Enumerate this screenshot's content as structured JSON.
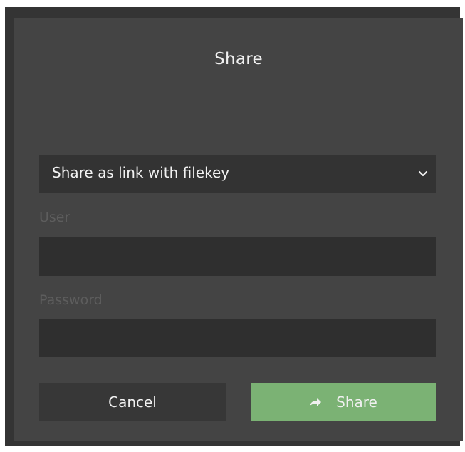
{
  "dialog": {
    "title": "Share",
    "share_mode": {
      "selected": "Share as link with filekey",
      "icon": "chevron-down-icon"
    },
    "user": {
      "label": "User",
      "value": ""
    },
    "password": {
      "label": "Password",
      "value": ""
    },
    "buttons": {
      "cancel": "Cancel",
      "share": "Share",
      "share_icon": "share-arrow-icon"
    }
  },
  "colors": {
    "dialog_bg": "#444444",
    "field_bg": "#2f2f2f",
    "accent": "#7bb274",
    "text": "#f0f0f0",
    "muted_label": "#5d5d5d"
  }
}
